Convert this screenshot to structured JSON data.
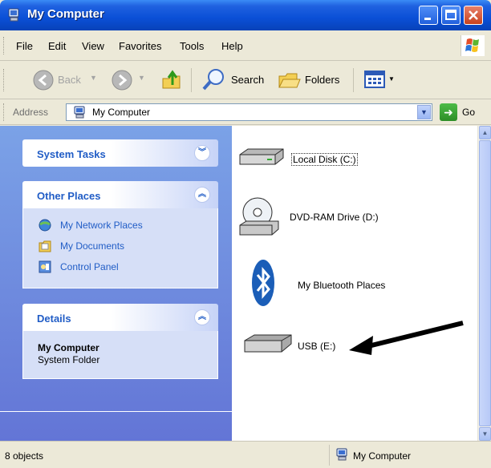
{
  "window": {
    "title": "My Computer"
  },
  "menu": {
    "items": [
      "File",
      "Edit",
      "View",
      "Favorites",
      "Tools",
      "Help"
    ]
  },
  "toolbar": {
    "back": "Back",
    "search": "Search",
    "folders": "Folders"
  },
  "address": {
    "label": "Address",
    "value": "My Computer",
    "go": "Go"
  },
  "tasks": {
    "system_tasks": {
      "title": "System Tasks"
    },
    "other_places": {
      "title": "Other Places",
      "links": [
        "My Network Places",
        "My Documents",
        "Control Panel"
      ]
    },
    "details": {
      "title": "Details",
      "name": "My Computer",
      "type": "System Folder"
    }
  },
  "items": [
    {
      "label": "Local Disk (C:)",
      "icon": "hard-disk-icon"
    },
    {
      "label": "DVD-RAM Drive (D:)",
      "icon": "dvd-drive-icon"
    },
    {
      "label": "My Bluetooth Places",
      "icon": "bluetooth-icon"
    },
    {
      "label": "USB (E:)",
      "icon": "usb-drive-icon"
    }
  ],
  "status": {
    "count": "8 objects",
    "location": "My Computer"
  },
  "colors": {
    "titlebar": "#0a4fd6",
    "taskpane": "#7ba2e7",
    "link": "#215dc6",
    "arrow": "#000000"
  }
}
